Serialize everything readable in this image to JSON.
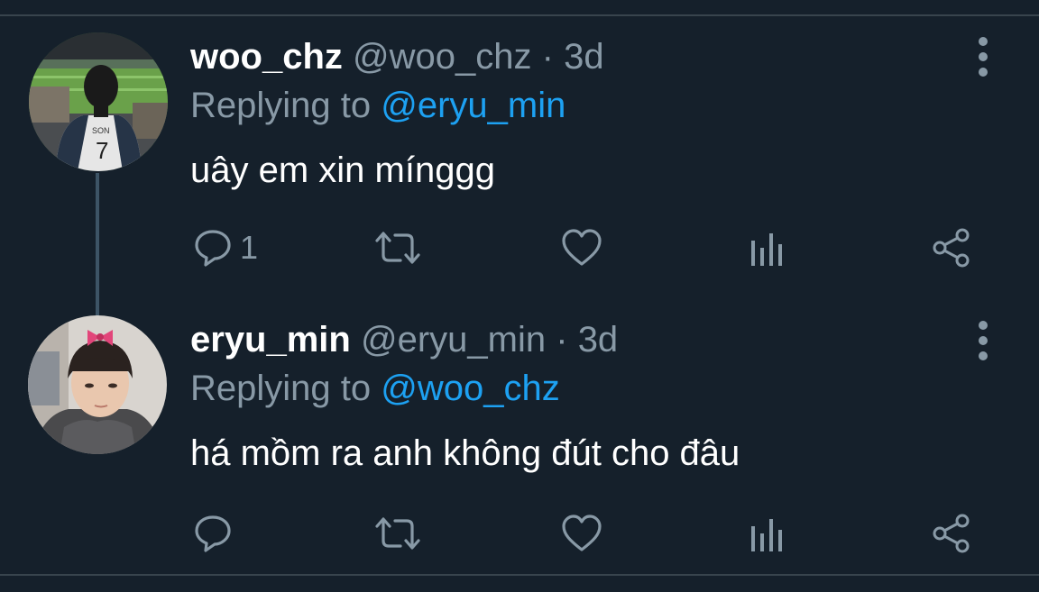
{
  "tweets": [
    {
      "display_name": "woo_chz",
      "handle": "@woo_chz",
      "separator": "·",
      "time": "3d",
      "replying_label": "Replying to",
      "replying_to": "@eryu_min",
      "text": "uây em xin mínggg",
      "reply_count": "1"
    },
    {
      "display_name": "eryu_min",
      "handle": "@eryu_min",
      "separator": "·",
      "time": "3d",
      "replying_label": "Replying to",
      "replying_to": "@woo_chz",
      "text": "há mồm ra anh không đút cho đâu",
      "reply_count": ""
    }
  ],
  "icons": {
    "reply": "reply-icon",
    "retweet": "retweet-icon",
    "like": "like-icon",
    "analytics": "analytics-icon",
    "share": "share-icon",
    "more": "more-vertical-icon"
  },
  "colors": {
    "background": "#15202b",
    "divider": "#38444d",
    "secondary_text": "#8899a6",
    "accent": "#1da1f2"
  }
}
